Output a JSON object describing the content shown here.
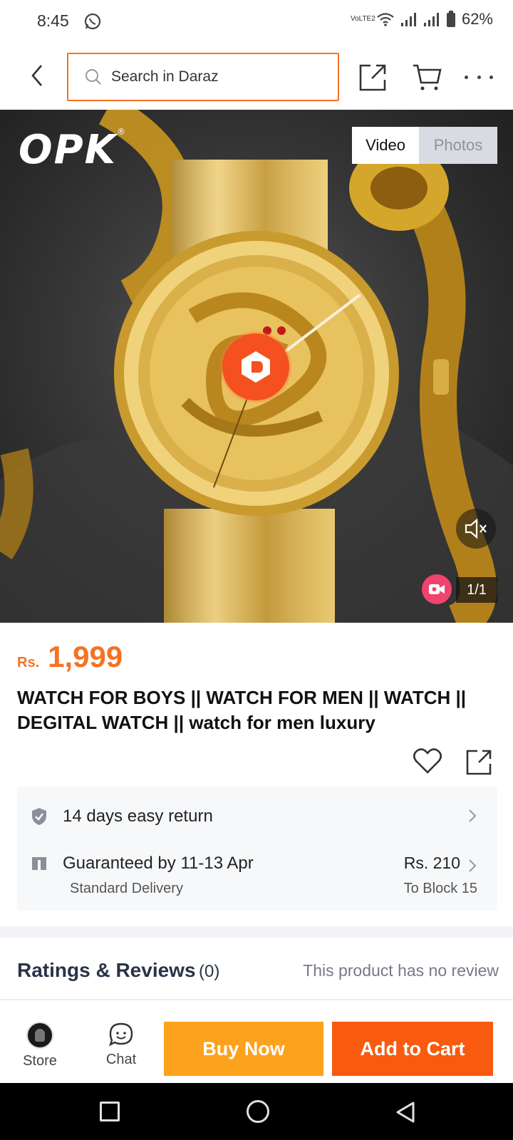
{
  "status_bar": {
    "time": "8:45",
    "network_label": "VoLTE2",
    "battery": "62%"
  },
  "topbar": {
    "search_placeholder": "Search in Daraz"
  },
  "media": {
    "brand": "OPK",
    "tab_video": "Video",
    "tab_photos": "Photos",
    "active_tab": "Video",
    "counter": "1/1"
  },
  "product": {
    "currency": "Rs.",
    "price": "1,999",
    "title": "WATCH FOR BOYS || WATCH FOR MEN || WATCH || DEGITAL WATCH || watch for men luxury"
  },
  "services": {
    "return_label": "14 days easy return",
    "delivery_label": "Guaranteed by 11-13 Apr",
    "delivery_type": "Standard Delivery",
    "delivery_fee": "Rs. 210",
    "destination": "To Block 15"
  },
  "ratings": {
    "title": "Ratings & Reviews",
    "count": "(0)",
    "note": "This product has no review"
  },
  "bottom_bar": {
    "store_label": "Store",
    "chat_label": "Chat",
    "buy_now_label": "Buy Now",
    "add_to_cart_label": "Add to Cart"
  },
  "colors": {
    "accent": "#f57224",
    "buy_now": "#fca21c",
    "add_to_cart": "#f85a10"
  }
}
